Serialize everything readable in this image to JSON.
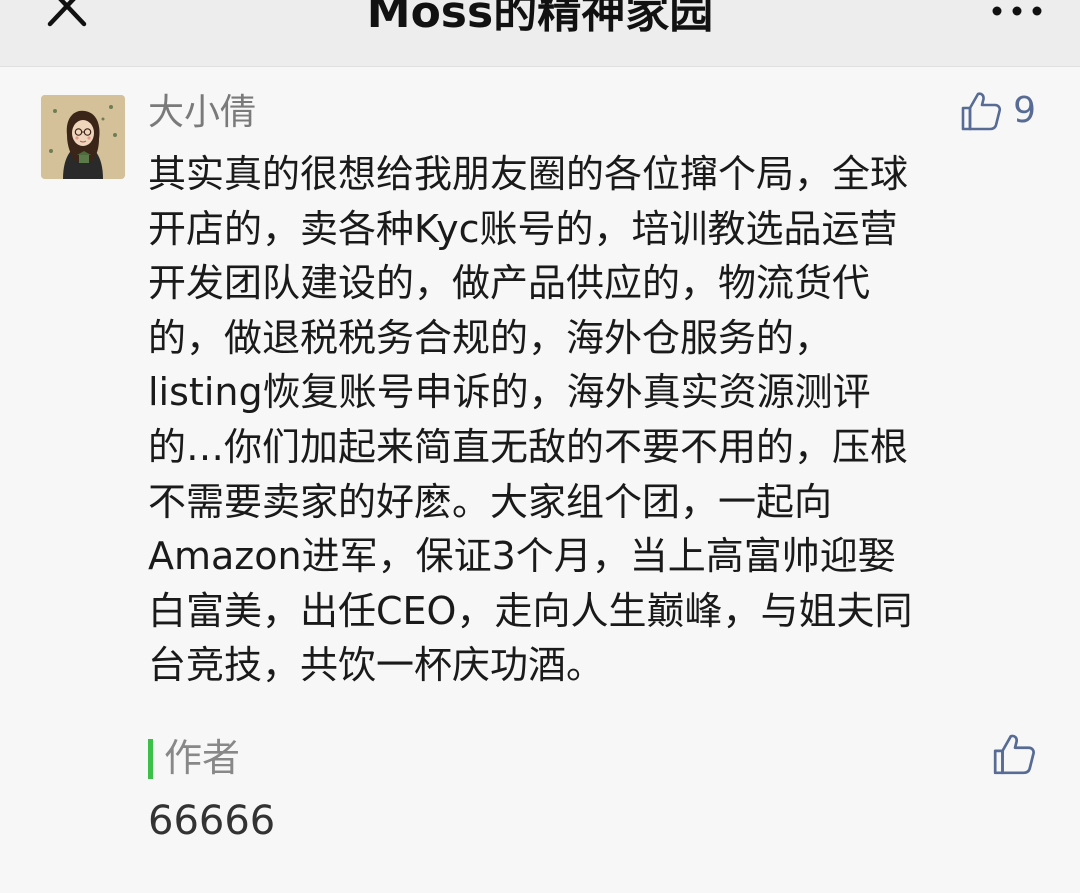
{
  "header": {
    "title": "Moss的精神家园",
    "close_icon": "close-icon",
    "more_icon": "more-icon"
  },
  "comment": {
    "username": "大小倩",
    "likes": "9",
    "text": "其实真的很想给我朋友圈的各位撺个局，全球\n开店的，卖各种Kyc账号的，培训教选品运营\n开发团队建设的，做产品供应的，物流货代\n的，做退税税务合规的，海外仓服务的，\nlisting恢复账号申诉的，海外真实资源测评\n的…你们加起来简直无敌的不要不用的，压根\n不需要卖家的好麽。大家组个团，一起向\nAmazon进军，保证3个月，当上高富帅迎娶\n白富美，出任CEO，走向人生巅峰，与姐夫同\n台竞技，共饮一杯庆功酒。",
    "avatar_icon": "avatar",
    "like_icon": "thumbs-up-icon"
  },
  "reply": {
    "label": "作者",
    "text": "66666",
    "like_icon": "thumbs-up-icon"
  },
  "colors": {
    "accent_blue": "#576b95",
    "author_green": "#3cc04a"
  }
}
